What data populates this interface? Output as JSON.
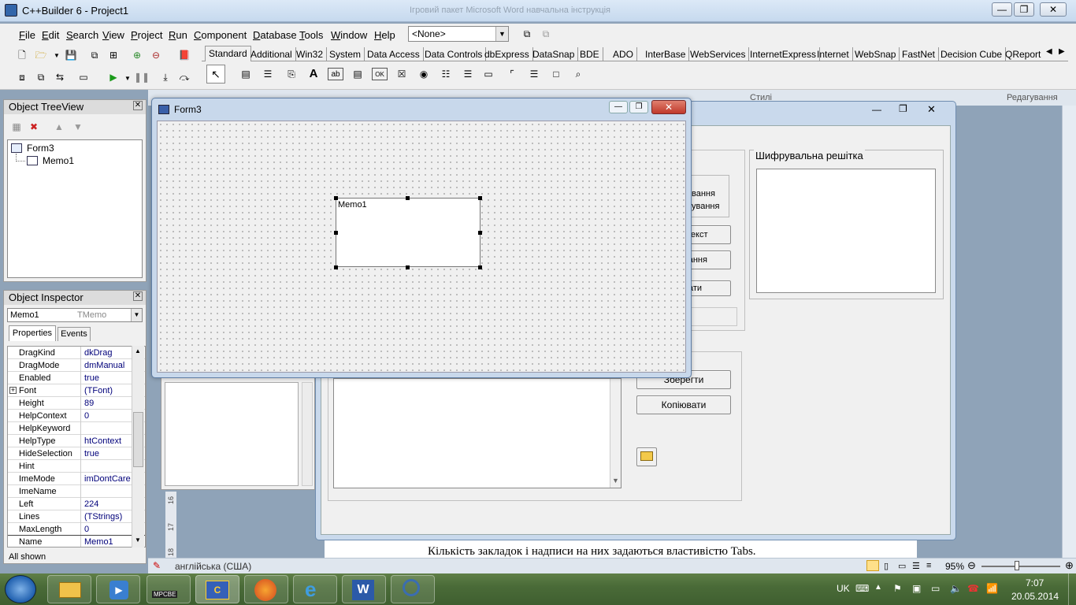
{
  "app_title": "C++Builder 6 - Project1",
  "bg_doc_title": "Ігровий пакет Microsoft Word навчальна інструкція",
  "window_controls": {
    "min": "—",
    "max": "❐",
    "close": "✕"
  },
  "menu": [
    "File",
    "Edit",
    "Search",
    "View",
    "Project",
    "Run",
    "Component",
    "Database",
    "Tools",
    "Window",
    "Help"
  ],
  "menu_underline": [
    "F",
    "E",
    "S",
    "V",
    "P",
    "R",
    "C",
    "D",
    "T",
    "W",
    "H"
  ],
  "target_combo": "<None>",
  "palette_tabs": [
    "Standard",
    "Additional",
    "Win32",
    "System",
    "Data Access",
    "Data Controls",
    "dbExpress",
    "DataSnap",
    "BDE",
    "ADO",
    "InterBase",
    "WebServices",
    "InternetExpress",
    "Internet",
    "WebSnap",
    "FastNet",
    "Decision Cube",
    "QReport"
  ],
  "palette_active": "Standard",
  "tree": {
    "title": "Object TreeView",
    "close": "✕",
    "root": "Form3",
    "child": "Memo1"
  },
  "inspector": {
    "title": "Object Inspector",
    "close": "✕",
    "object_name": "Memo1",
    "object_type": "TMemo",
    "tab_properties": "Properties",
    "tab_events": "Events",
    "rows": [
      {
        "name": "DragKind",
        "value": "dkDrag"
      },
      {
        "name": "DragMode",
        "value": "dmManual"
      },
      {
        "name": "Enabled",
        "value": "true"
      },
      {
        "name": "Font",
        "value": "(TFont)",
        "expand": "+"
      },
      {
        "name": "Height",
        "value": "89"
      },
      {
        "name": "HelpContext",
        "value": "0"
      },
      {
        "name": "HelpKeyword",
        "value": ""
      },
      {
        "name": "HelpType",
        "value": "htContext"
      },
      {
        "name": "HideSelection",
        "value": "true"
      },
      {
        "name": "Hint",
        "value": ""
      },
      {
        "name": "ImeMode",
        "value": "imDontCare"
      },
      {
        "name": "ImeName",
        "value": ""
      },
      {
        "name": "Left",
        "value": "224"
      },
      {
        "name": "Lines",
        "value": "(TStrings)"
      },
      {
        "name": "MaxLength",
        "value": "0"
      },
      {
        "name": "Name",
        "value": "Memo1"
      }
    ],
    "status": "All shown"
  },
  "form3": {
    "title": "Form3",
    "memo_text": "Memo1"
  },
  "bg_form": {
    "group_title": "Шифрувальна решітка",
    "btn_partial_1a": "вання",
    "btn_partial_1b": "ування",
    "btn_partial_2": "текст",
    "btn_partial_3": "вання",
    "btn_partial_4": "ати",
    "btn_save": "Зберегти",
    "btn_copy": "Копіювати"
  },
  "word": {
    "styles_label": "Стилі",
    "editing_label": "Редагування",
    "doc_text": "Кількість закладок і надписи на них задаються властивістю Tabs.",
    "language": "англійська (США)",
    "zoom": "95%",
    "ruler_numbers": [
      "16",
      "17",
      "18"
    ]
  },
  "taskbar": {
    "lang": "UK",
    "time": "7:07",
    "date": "20.05.2014",
    "apps": [
      "explorer",
      "media-player",
      "mpc-be",
      "cpp-builder",
      "firefox",
      "internet-explorer",
      "word",
      "search-tool"
    ],
    "app_labels": {
      "mpc-be": "MPCBE"
    }
  }
}
